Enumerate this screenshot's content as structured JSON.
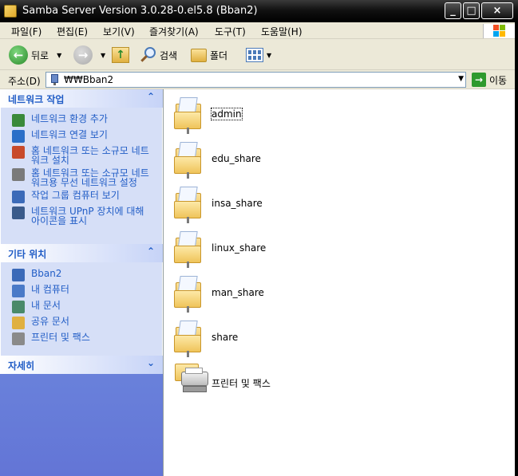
{
  "window": {
    "title": "Samba Server Version 3.0.28-0.el5.8 (Bban2)",
    "minimize": "_",
    "maximize": "□",
    "close": "×"
  },
  "menu": {
    "items": [
      "파일(F)",
      "편집(E)",
      "보기(V)",
      "즐겨찾기(A)",
      "도구(T)",
      "도움말(H)"
    ]
  },
  "toolbar": {
    "back_label": "뒤로",
    "search_label": "검색",
    "folders_label": "폴더"
  },
  "address": {
    "label": "주소(D)",
    "value": "₩₩Bban2",
    "go_label": "이동"
  },
  "tasks": {
    "network_tasks": {
      "title": "네트워크 작업",
      "items": [
        {
          "label": "네트워크 환경 추가",
          "icon": "add-network-place-icon",
          "color": "#3a8a3a"
        },
        {
          "label": "네트워크 연결 보기",
          "icon": "network-connections-icon",
          "color": "#2b6fc8"
        },
        {
          "label": "홈 네트워크 또는 소규모 네트워크 설치",
          "icon": "home-network-icon",
          "color": "#c84a2b"
        },
        {
          "label": "홈 네트워크 또는 소규모 네트워크용 무선 네트워크 설정",
          "icon": "wireless-network-icon",
          "color": "#7a7a7a"
        },
        {
          "label": "작업 그룹 컴퓨터 보기",
          "icon": "workgroup-computers-icon",
          "color": "#3b6ab8"
        },
        {
          "label": "네트워크 UPnP 장치에 대해 아이콘을 표시",
          "icon": "upnp-device-icon",
          "color": "#3a5a8a"
        }
      ]
    },
    "other_places": {
      "title": "기타 위치",
      "items": [
        {
          "label": "Bban2",
          "icon": "network-computer-icon",
          "color": "#3b6ab8"
        },
        {
          "label": "내 컴퓨터",
          "icon": "my-computer-icon",
          "color": "#4a7ac8"
        },
        {
          "label": "내 문서",
          "icon": "my-documents-icon",
          "color": "#4a8a6a"
        },
        {
          "label": "공유 문서",
          "icon": "shared-documents-icon",
          "color": "#e0b040"
        },
        {
          "label": "프린터 및 팩스",
          "icon": "printer-icon",
          "color": "#8a8a8a"
        }
      ]
    },
    "details": {
      "title": "자세히"
    }
  },
  "files": {
    "items": [
      {
        "label": "admin",
        "icon": "network-folder-icon",
        "selected": true
      },
      {
        "label": "edu_share",
        "icon": "network-folder-icon",
        "selected": false
      },
      {
        "label": "insa_share",
        "icon": "network-folder-icon",
        "selected": false
      },
      {
        "label": "linux_share",
        "icon": "network-folder-icon",
        "selected": false
      },
      {
        "label": "man_share",
        "icon": "network-folder-icon",
        "selected": false
      },
      {
        "label": "share",
        "icon": "network-folder-icon",
        "selected": false
      },
      {
        "label": "프린터 및 팩스",
        "icon": "printer-icon",
        "selected": false
      }
    ]
  }
}
